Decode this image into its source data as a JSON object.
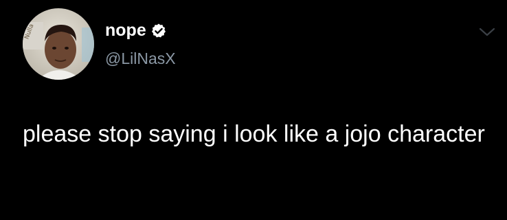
{
  "tweet": {
    "author": {
      "display_name": "nope",
      "handle": "@LilNasX",
      "verified": true,
      "avatar_icon": "profile-photo"
    },
    "text": "please stop saying i look like a jojo character",
    "more_icon": "chevron-down-icon"
  },
  "colors": {
    "background": "#000000",
    "primary_text": "#ffffff",
    "secondary_text": "#8b98a5",
    "verified_badge": "#ffffff",
    "chevron": "#3b4046"
  }
}
